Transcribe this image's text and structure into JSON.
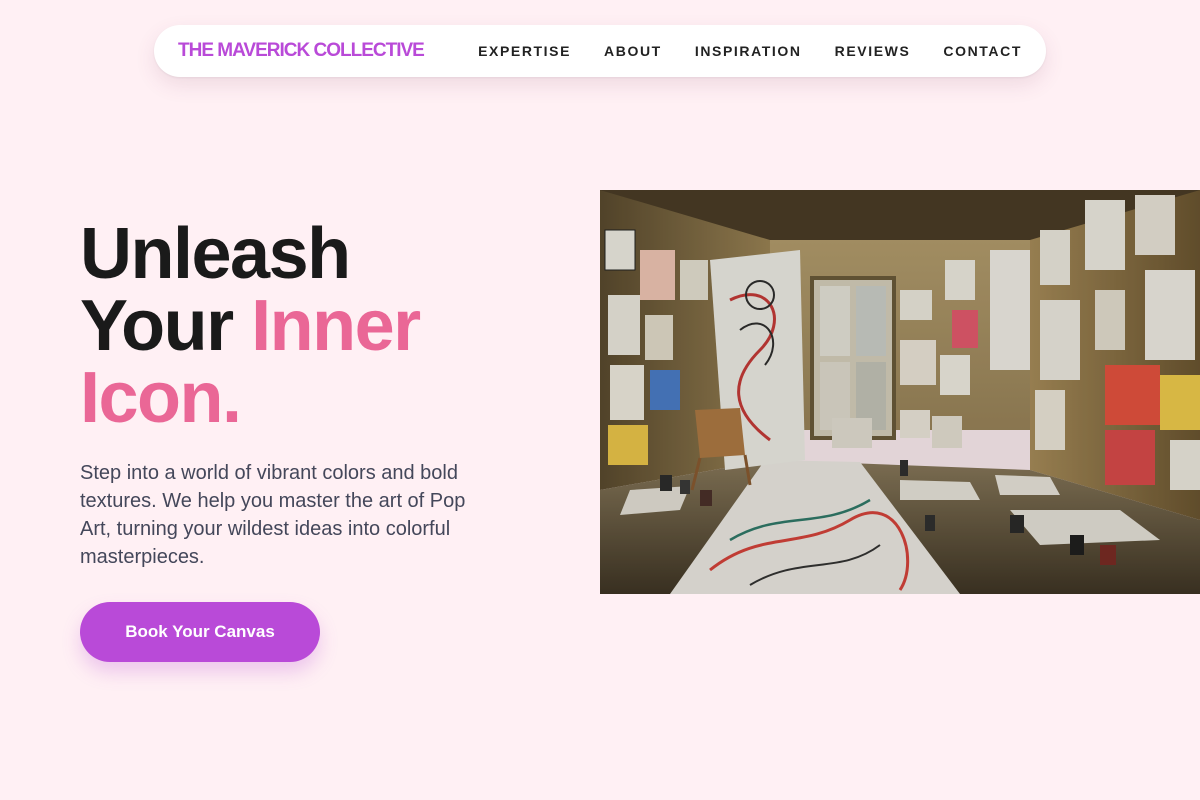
{
  "nav": {
    "brand": "THE MAVERICK COLLECTIVE",
    "links": [
      {
        "label": "EXPERTISE"
      },
      {
        "label": "ABOUT"
      },
      {
        "label": "INSPIRATION"
      },
      {
        "label": "REVIEWS"
      },
      {
        "label": "CONTACT"
      }
    ]
  },
  "hero": {
    "headline_line1": "Unleash",
    "headline_line2_plain": "Your ",
    "headline_line2_accent": "Inner",
    "headline_line3_accent": "Icon.",
    "description": "Step into a world of vibrant colors and bold textures. We help you master the art of Pop Art, turning your wildest ideas into colorful masterpieces.",
    "cta_label": "Book Your Canvas"
  },
  "image": {
    "subject": "art studio room with drawings covering the walls and floor"
  },
  "colors": {
    "background": "#fff0f4",
    "brand_purple": "#b94ad8",
    "accent_pink": "#ea6796",
    "headline_dark": "#1a1a1a",
    "body_text": "#44475a"
  }
}
